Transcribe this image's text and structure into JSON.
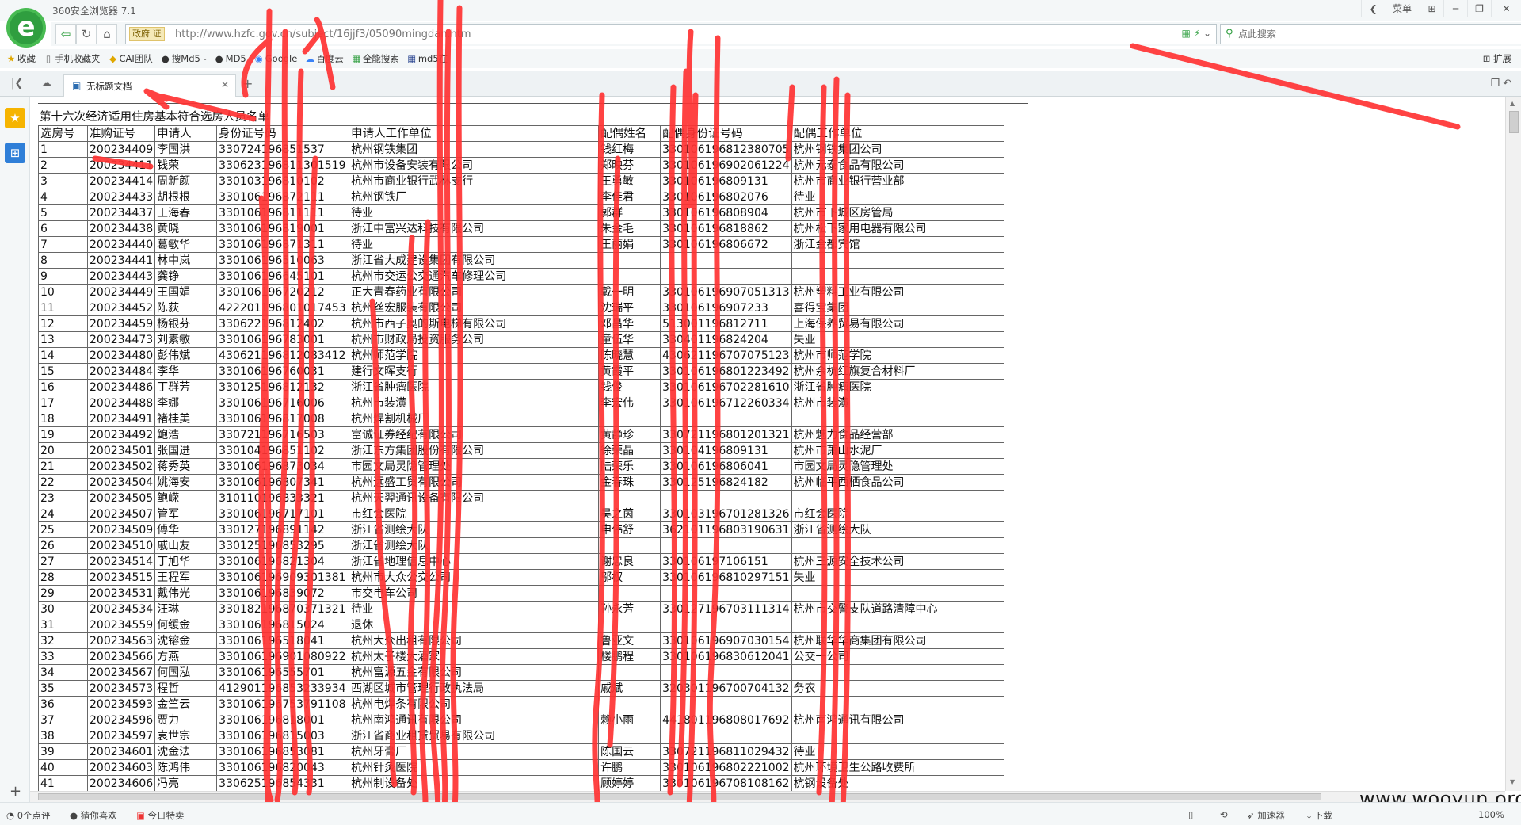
{
  "browser": {
    "app_title": "360安全浏览器 7.1",
    "logo_letter": "e",
    "menu_label": "菜单",
    "window_btns": [
      "❮",
      "⊞",
      "─",
      "❐",
      "✕"
    ],
    "url": "http://www.hzfc.gov.cn/subject/16jjf3/05090mingdan.htm",
    "gov_badge": "政府 证",
    "search_placeholder": "点此搜索",
    "bookmarks": [
      {
        "icon": "★",
        "label": "收藏"
      },
      {
        "icon": "▯",
        "label": "手机收藏夹"
      },
      {
        "icon": "◆",
        "label": "CAI团队"
      },
      {
        "icon": "●",
        "label": "搜Md5 -"
      },
      {
        "icon": "●",
        "label": "MD5"
      },
      {
        "icon": "◉",
        "label": "Google"
      },
      {
        "icon": "☁",
        "label": "百度云"
      },
      {
        "icon": "▦",
        "label": "全能搜索"
      },
      {
        "icon": "▦",
        "label": "md5在"
      }
    ],
    "extensions_label": "扩展",
    "tab_title": "无标题文档",
    "status": {
      "comments": "0个点评",
      "guess": "猜你喜欢",
      "daily": "今日特卖",
      "accelerator": "加速器",
      "download": "下载",
      "zoom": "100%"
    }
  },
  "document": {
    "title": "第十六次经济适用住房基本符合选房人员名单",
    "headers": [
      "选房号",
      "准购证号",
      "申请人",
      "身份证号码",
      "申请人工作单位",
      "配偶姓名",
      "配偶身份证号码",
      "配偶工作单位"
    ],
    "rows": [
      [
        "1",
        "200234409",
        "李国洪",
        "330724196851537",
        "杭州钢铁集团",
        "钱红梅",
        "330106196812380705",
        "杭州钢铁集团公司"
      ],
      [
        "2",
        "200234411",
        "钱荣",
        "330623196811301519",
        "杭州市设备安装有限公司",
        "郑映芬",
        "330106196902061224",
        "杭州元泰食品有限公司"
      ],
      [
        "3",
        "200234414",
        "周新颜",
        "330103196810102",
        "杭州市商业银行武林支行",
        "王勇敏",
        "330106196809131",
        "杭州市商业银行营业部"
      ],
      [
        "4",
        "200234433",
        "胡根根",
        "330106196872111",
        "杭州钢铁厂",
        "李佳君",
        "330106196802076",
        "待业"
      ],
      [
        "5",
        "200234437",
        "王海春",
        "330106196811111",
        "待业",
        "郭群",
        "330106196808904",
        "杭州市下城区房管局"
      ],
      [
        "6",
        "200234438",
        "黄晓",
        "330106196819001",
        "浙江中富兴达科技有限公司",
        "朱金毛",
        "330106196818862",
        "杭州松下家用电器有限公司"
      ],
      [
        "7",
        "200234440",
        "葛敏华",
        "330106196871311",
        "待业",
        "王丽娟",
        "330106196806672",
        "浙江金都宾馆"
      ],
      [
        "8",
        "200234441",
        "林中岚",
        "330106196510063",
        "浙江省大成建设集团有限公司",
        "",
        "",
        ""
      ],
      [
        "9",
        "200234443",
        "龚铮",
        "330106196645101",
        "杭州市交运公交通汽车修理公司",
        "",
        "",
        ""
      ],
      [
        "10",
        "200234449",
        "王国娟",
        "330106196720212",
        "正大青春药业有限公司",
        "戴一明",
        "330106196907051313",
        "杭州塑料工业有限公司"
      ],
      [
        "11",
        "200234452",
        "陈荻",
        "422201196801017453",
        "杭州丝宏服装有限公司",
        "沈瑞平",
        "330106196907233",
        "喜得宝集团"
      ],
      [
        "12",
        "200234459",
        "杨银芬",
        "330622196812402",
        "杭州市西子奥的斯电梯有限公司",
        "邓昌华",
        "513001196812711",
        "上海保养贸易有限公司"
      ],
      [
        "13",
        "200234473",
        "刘素敏",
        "330106196783001",
        "杭州市财政局投资服务公司",
        "童伍华",
        "330401196824204",
        "失业"
      ],
      [
        "14",
        "200234480",
        "彭伟斌",
        "430621196812083412",
        "杭州师范学院",
        "陈晓慧",
        "430621196707075123",
        "杭州市师范学院"
      ],
      [
        "15",
        "200234484",
        "李华",
        "330106196760031",
        "建行文晖支行",
        "黄霞平",
        "330106196801223492",
        "杭州余杭红旗复合材料厂"
      ],
      [
        "16",
        "200234486",
        "丁群芳",
        "330125196812132",
        "浙江省肿瘤医院",
        "钱俊",
        "330106196702281610",
        "浙江省肿瘤医院"
      ],
      [
        "17",
        "200234488",
        "李娜",
        "330106196716006",
        "杭州市装潢",
        "李宏伟",
        "330106196712260334",
        "杭州市装潢"
      ],
      [
        "18",
        "200234491",
        "褚桂美",
        "330106196817008",
        "杭州焊割机械厂",
        "",
        "",
        ""
      ],
      [
        "19",
        "200234492",
        "鲍浩",
        "330721196716503",
        "富诚证券经纪有限公司",
        "黄静珍",
        "330721196801201321",
        "杭州魅力食品经营部"
      ],
      [
        "20",
        "200234501",
        "张国进",
        "330104196851102",
        "浙江东方集团股份有限公司",
        "徐荣晶",
        "330104196809131",
        "杭州市萧山水泥厂"
      ],
      [
        "21",
        "200234502",
        "蒋秀英",
        "330106196873034",
        "市园文局灵隐管理处",
        "陆荣乐",
        "330106196806041",
        "市园文局灵隐管理处"
      ],
      [
        "22",
        "200234504",
        "姚海安",
        "330106196807341",
        "杭州远盛工贸有限公司",
        "金春珠",
        "330125196824182",
        "杭州临平西栖食品公司"
      ],
      [
        "23",
        "200234505",
        "鲍嵘",
        "310110196833321",
        "杭州天羿通讯设备有限公司",
        "",
        "",
        ""
      ],
      [
        "24",
        "200234507",
        "管军",
        "330106196717101",
        "市红会医院",
        "吴之茵",
        "330103196701281326",
        "市红会医院"
      ],
      [
        "25",
        "200234509",
        "傅华",
        "330127196891142",
        "浙江省测绘大队",
        "申伟舒",
        "362101196803190631",
        "浙江省测绘大队"
      ],
      [
        "26",
        "200234510",
        "戚山友",
        "330125196853295",
        "浙江省测绘大队",
        "",
        "",
        ""
      ],
      [
        "27",
        "200234514",
        "丁旭华",
        "330106196821304",
        "浙江省地理信息中心",
        "谢忠良",
        "330106197106151",
        "杭州三源安全技术公司"
      ],
      [
        "28",
        "200234515",
        "王程军",
        "330106196909301381",
        "杭州市大众公交公司",
        "邬权",
        "330106196810297151",
        "失业"
      ],
      [
        "29",
        "200234531",
        "戴伟光",
        "330106196839072",
        "市交电车公司",
        "",
        "",
        ""
      ],
      [
        "30",
        "200234534",
        "汪琳",
        "330182196870371321",
        "待业",
        "孙永芳",
        "330127196703111314",
        "杭州市交警支队道路清障中心"
      ],
      [
        "31",
        "200234559",
        "何缓金",
        "330106196815024",
        "退休",
        "",
        "",
        ""
      ],
      [
        "32",
        "200234563",
        "沈镕金",
        "330106196518041",
        "杭州大众出租有限公司",
        "鲁亚文",
        "330106196907030154",
        "杭州联华华商集团有限公司"
      ],
      [
        "33",
        "200234566",
        "方燕",
        "330106196901080922",
        "杭州太子楼大酒家",
        "楼鹏程",
        "330106196830612041",
        "公交一公司"
      ],
      [
        "34",
        "200234567",
        "何国泓",
        "330106196555701",
        "杭州富源五金有限公司",
        "",
        "",
        ""
      ],
      [
        "35",
        "200234573",
        "程哲",
        "412901196853233934",
        "西湖区城市管理行政执法局",
        "戚斌",
        "320301196700704132",
        "务农"
      ],
      [
        "36",
        "200234593",
        "金竺云",
        "330106196753791108",
        "杭州电焊条有限公司",
        "",
        "",
        ""
      ],
      [
        "37",
        "200234596",
        "贾力",
        "330106196818001",
        "杭州南鸿通讯有限公司",
        "赖小雨",
        "441801196808017692",
        "杭州南鸿通讯有限公司"
      ],
      [
        "38",
        "200234597",
        "袁世宗",
        "330106196815003",
        "浙江省商业租赁贸易有限公司",
        "",
        "",
        ""
      ],
      [
        "39",
        "200234601",
        "沈金法",
        "330106196853081",
        "杭州牙膏厂",
        "陈国云",
        "330721196811029432",
        "待业"
      ],
      [
        "40",
        "200234603",
        "陈鸿伟",
        "330106196820043",
        "杭州针灸医院",
        "许鹏",
        "330106196802221002",
        "杭州环境卫生公路收费所"
      ],
      [
        "41",
        "200234606",
        "冯亮",
        "330625196854331",
        "杭州制设备处",
        "顾婷婷",
        "330106196708108162",
        "杭钢设备处"
      ]
    ]
  },
  "watermark": "www.wooyun.org"
}
